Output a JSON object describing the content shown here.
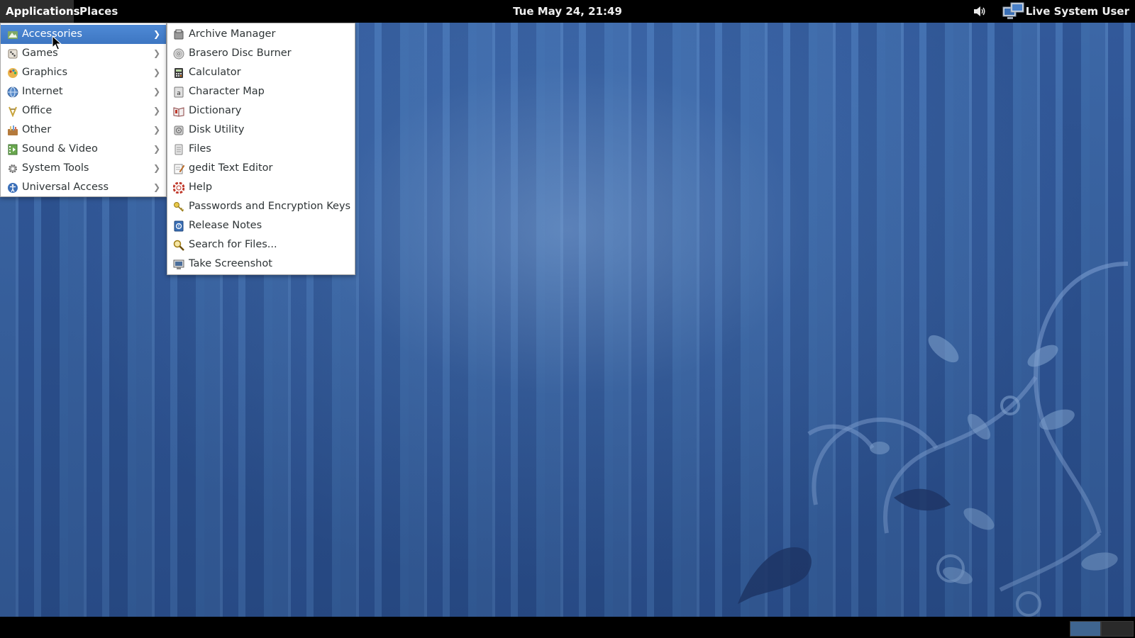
{
  "top_bar": {
    "applications_label": "Applications",
    "places_label": "Places",
    "clock": "Tue May 24, 21:49",
    "user_label": "Live System User",
    "icons": [
      "volume-icon",
      "network-icon"
    ]
  },
  "categories_menu": {
    "items": [
      {
        "label": "Accessories",
        "icon": "accessories-icon",
        "active": true
      },
      {
        "label": "Games",
        "icon": "games-icon"
      },
      {
        "label": "Graphics",
        "icon": "graphics-icon"
      },
      {
        "label": "Internet",
        "icon": "internet-icon"
      },
      {
        "label": "Office",
        "icon": "office-icon"
      },
      {
        "label": "Other",
        "icon": "other-icon"
      },
      {
        "label": "Sound & Video",
        "icon": "sound-video-icon"
      },
      {
        "label": "System Tools",
        "icon": "system-tools-icon"
      },
      {
        "label": "Universal Access",
        "icon": "universal-access-icon"
      }
    ]
  },
  "accessories_submenu": {
    "items": [
      {
        "label": "Archive Manager",
        "icon": "archive-manager-icon"
      },
      {
        "label": "Brasero Disc Burner",
        "icon": "disc-burner-icon"
      },
      {
        "label": "Calculator",
        "icon": "calculator-icon"
      },
      {
        "label": "Character Map",
        "icon": "character-map-icon"
      },
      {
        "label": "Dictionary",
        "icon": "dictionary-icon"
      },
      {
        "label": "Disk Utility",
        "icon": "disk-utility-icon"
      },
      {
        "label": "Files",
        "icon": "files-icon"
      },
      {
        "label": "gedit Text Editor",
        "icon": "text-editor-icon"
      },
      {
        "label": "Help",
        "icon": "help-icon"
      },
      {
        "label": "Passwords and Encryption Keys",
        "icon": "keys-icon"
      },
      {
        "label": "Release Notes",
        "icon": "release-notes-icon"
      },
      {
        "label": "Search for Files...",
        "icon": "search-icon"
      },
      {
        "label": "Take Screenshot",
        "icon": "screenshot-icon"
      }
    ]
  },
  "bottom_bar": {
    "workspaces": [
      {
        "active": true
      },
      {
        "active": false
      }
    ]
  },
  "colors": {
    "menu_highlight": "#4a83d0",
    "desktop_blue": "#3c67a6",
    "panel_black": "#000000"
  }
}
